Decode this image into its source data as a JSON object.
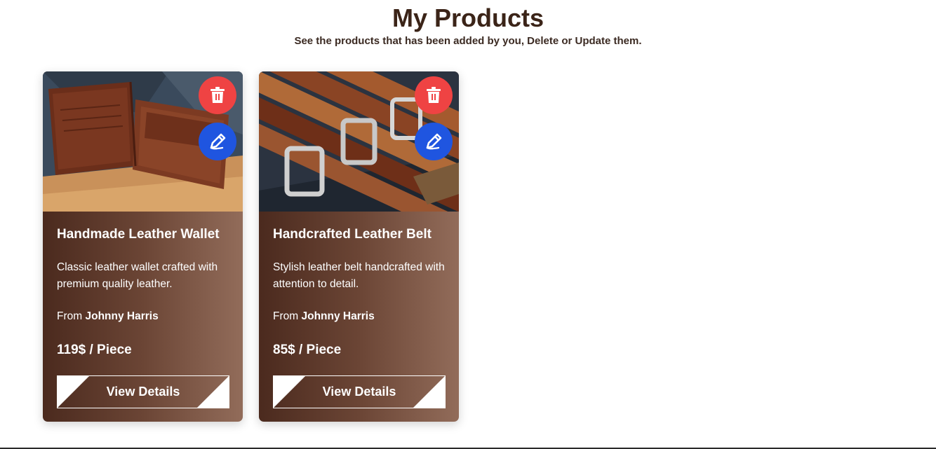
{
  "header": {
    "title": "My Products",
    "subtitle": "See the products that has been added by you, Delete or Update them."
  },
  "products": [
    {
      "title": "Handmade Leather Wallet",
      "description": "Classic leather wallet crafted with premium quality leather.",
      "from_prefix": "From",
      "seller": "Johnny Harris",
      "price": "119$ / Piece",
      "button_label": "View Details",
      "image": "leather-wallet-photo"
    },
    {
      "title": "Handcrafted Leather Belt",
      "description": "Stylish leather belt handcrafted with attention to detail.",
      "from_prefix": "From",
      "seller": "Johnny Harris",
      "price": "85$ / Piece",
      "button_label": "View Details",
      "image": "leather-belts-photo"
    }
  ],
  "icons": {
    "delete": "trash-icon",
    "edit": "pencil-icon"
  },
  "colors": {
    "title": "#3b2418",
    "card_gradient_start": "#4b2a1e",
    "card_gradient_end": "#926c5a",
    "delete_button": "#ef4343",
    "edit_button": "#1f55e0"
  }
}
